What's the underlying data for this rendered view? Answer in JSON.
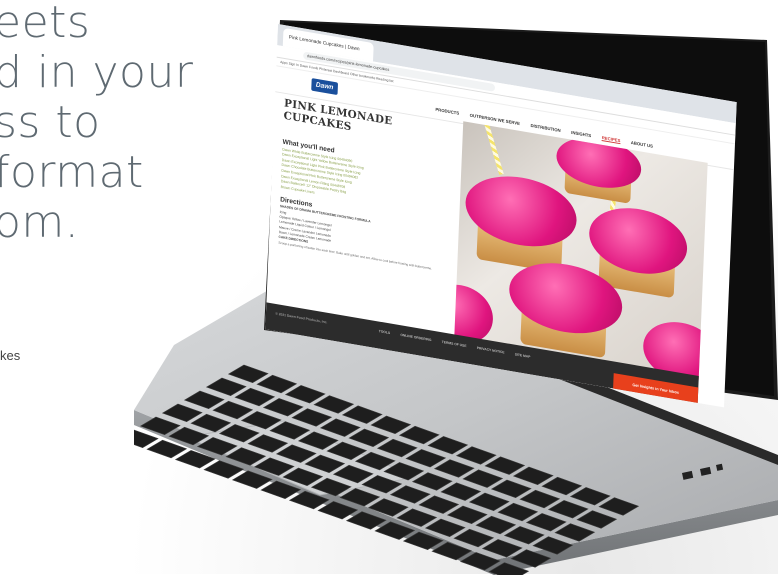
{
  "headline": {
    "lines": [
      "eets",
      "d in your",
      "ss to",
      "format",
      "om."
    ]
  },
  "caption": {
    "text": "kes"
  },
  "browser": {
    "tab_title": "Pink Lemonade Cupcakes | Dawn",
    "url": "dawnfoods.com/recipes/pink-lemonade-cupcakes",
    "bookmarks": "Apps  Sign In  Dawn Foods  Pinterest  Dashboard  Other bookmarks  Reading list"
  },
  "site": {
    "logo": "Dawn",
    "nav": [
      "PRODUCTS",
      "OUTPERSON WE SERVE",
      "DISTRIBUTION",
      "INSIGHTS",
      "RECIPES",
      "ABOUT US"
    ],
    "active_nav": "RECIPES"
  },
  "recipe": {
    "title": "PINK LEMONADE CUPCAKES",
    "need_heading": "What you'll need",
    "ingredients": [
      "Dawn White Buttercreme Style Icing 00494090",
      "Dawn Exceptional Light Yellow Buttercreme Style Icing",
      "Dawn Exceptional Light Pink Buttercreme Style Icing",
      "Dawn Chocolate Buttercreme Style Icing 00494082",
      "Dawn Exceptional Pink Buttercreme Style Icing",
      "Dawn Exceptional Lemon Filling 00448708",
      "Dawn Balance® 12\" Disposable Pastry Bag",
      "Brown Cupcake Liners"
    ],
    "directions_heading": "Directions",
    "sub_heading": "SHADES OF DRAMA BUTTERCREME FROSTING FORMULA",
    "direction_items": [
      "Icing",
      "Opaque Yellow / Lavender Lemongel",
      "Lemonade Liquid Colour / Lemongel",
      "Mauve / Creme Lavender Lemonade",
      "Dawn / Lemonade Cream Lemonade"
    ],
    "cake_heading": "CAKE DIRECTIONS",
    "paragraph": "Scoop a portioning of batter into each liner. Bake until golden and set. Allow to cool before frosting with buttercreme."
  },
  "footer": {
    "copyright": "© 2021 Dawn Food Products, Inc.",
    "links": [
      "TOOLS",
      "ONLINE ORDERING",
      "TERMS OF USE",
      "PRIVACY NOTICE",
      "SITE MAP"
    ],
    "cta": "Get Insights in Your Inbox"
  },
  "colors": {
    "headline": "#5f6a72",
    "accent": "#e8401c",
    "frosting": "#e0157f",
    "ingredient": "#8aa14b"
  }
}
